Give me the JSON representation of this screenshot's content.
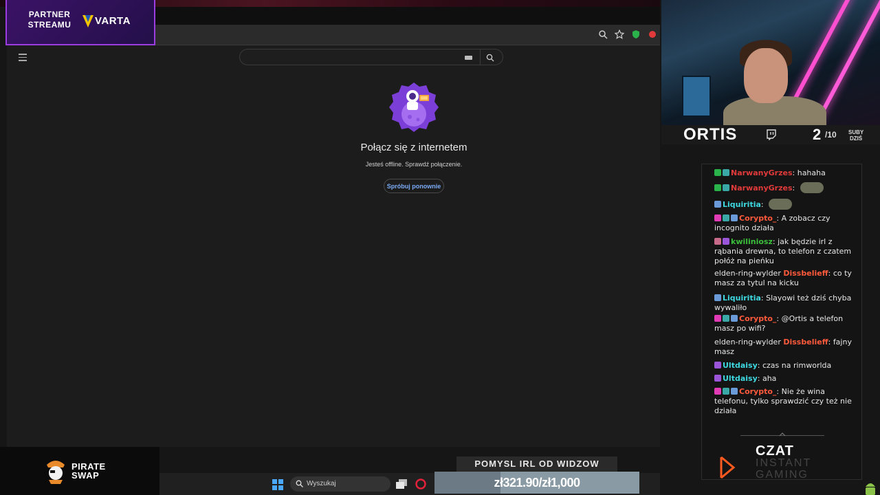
{
  "sponsor_top": {
    "line1": "PARTNER",
    "line2": "STREAMU",
    "brand": "VARTA"
  },
  "sponsor_bottom": {
    "line1": "PIRATE",
    "line2": "SWAP"
  },
  "browser": {
    "offline_title": "Połącz się z internetem",
    "offline_subtitle": "Jesteś offline. Sprawdź połączenie.",
    "retry_label": "Spróbuj ponownie",
    "accent": "#7cacf8"
  },
  "taskbar": {
    "search_placeholder": "Wyszukaj"
  },
  "overlay": {
    "idea_label": "POMYSL IRL OD WIDZOW",
    "donation_text": "zł321.90/zł1,000",
    "donation_progress": 0.3219
  },
  "streamer": {
    "name": "ORTIS",
    "subs_count": "2",
    "subs_goal": "/10",
    "subs_label_1": "SUBY",
    "subs_label_2": "DZIŚ"
  },
  "chat": {
    "messages": [
      {
        "badges": [
          "b-green",
          "b-teal"
        ],
        "user": "NarwanyGrzes",
        "color": "u-red",
        "text": "hahaha"
      },
      {
        "badges": [
          "b-green",
          "b-teal"
        ],
        "user": "NarwanyGrzes",
        "color": "u-red",
        "text": "",
        "emote": true
      },
      {
        "badges": [
          "b-blue"
        ],
        "user": "Liquiritia",
        "color": "u-cyan",
        "text": "",
        "emote": true
      },
      {
        "badges": [
          "b-pink",
          "b-teal",
          "b-blue"
        ],
        "user": "Corypto_",
        "color": "u-orange",
        "text": "A zobacz czy incognito działa"
      },
      {
        "badges": [
          "b-rose",
          "b-purple"
        ],
        "user": "kwiliniosz",
        "color": "u-green",
        "text": "jak będzie irl z rąbania drewna, to telefon z czatem połóż na pieńku"
      },
      {
        "badges": [],
        "prefix": "elden-ring-wylder",
        "user": "Dissbelieff",
        "color": "u-orange",
        "text": "co ty masz za tytul na kicku"
      },
      {
        "badges": [
          "b-blue"
        ],
        "user": "Liquiritia",
        "color": "u-cyan",
        "text": "Slayowi też dziś chyba wywaliło"
      },
      {
        "badges": [
          "b-pink",
          "b-teal",
          "b-blue"
        ],
        "user": "Corypto_",
        "color": "u-orange",
        "text": "@Ortis a telefon masz po wifi?"
      },
      {
        "badges": [],
        "prefix": "elden-ring-wylder",
        "user": "Dissbelieff",
        "color": "u-orange",
        "text": "fajny masz"
      },
      {
        "badges": [
          "b-purple"
        ],
        "user": "Ultdaisy",
        "color": "u-cyan",
        "text": "czas na rimworlda"
      },
      {
        "badges": [
          "b-purple"
        ],
        "user": "Ultdaisy",
        "color": "u-cyan",
        "text": "aha"
      },
      {
        "badges": [
          "b-pink",
          "b-teal",
          "b-blue"
        ],
        "user": "Corypto_",
        "color": "u-orange",
        "text": "Nie że wina telefonu, tylko sprawdzić czy też nie działa"
      }
    ],
    "footer_title": "CZAT",
    "footer_line1": "INSTANT",
    "footer_line2": "GAMING"
  }
}
